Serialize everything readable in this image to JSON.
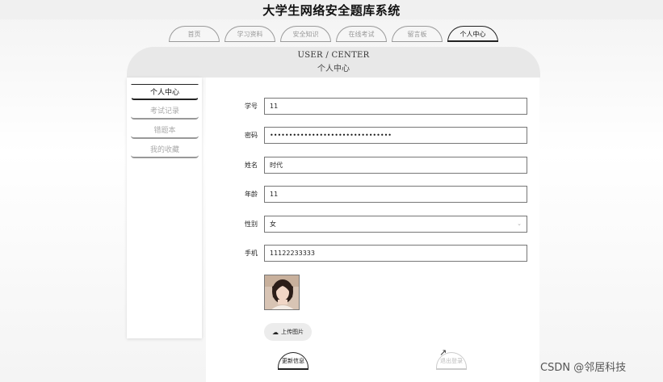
{
  "app": {
    "title": "大学生网络安全题库系统"
  },
  "nav": {
    "tabs": [
      {
        "label": "首页"
      },
      {
        "label": "学习资料"
      },
      {
        "label": "安全知识"
      },
      {
        "label": "在线考试"
      },
      {
        "label": "留言板"
      },
      {
        "label": "个人中心",
        "active": true
      }
    ]
  },
  "banner": {
    "title_en": "USER / CENTER",
    "title_zh": "个人中心"
  },
  "sidebar": {
    "items": [
      {
        "label": "个人中心",
        "active": true
      },
      {
        "label": "考试记录"
      },
      {
        "label": "错题本"
      },
      {
        "label": "我的收藏"
      }
    ]
  },
  "form": {
    "student_id": {
      "label": "学号",
      "value": "11"
    },
    "password": {
      "label": "密码",
      "value": "••••••••••••••••••••••••••••••••"
    },
    "name": {
      "label": "姓名",
      "value": "时代"
    },
    "age": {
      "label": "年龄",
      "value": "11"
    },
    "gender": {
      "label": "性别",
      "value": "女"
    },
    "phone": {
      "label": "手机",
      "value": "11122233333"
    },
    "upload_label": "上传图片",
    "update_label": "更新信息",
    "logout_label": "退出登录"
  },
  "watermark": "CSDN @邻居科技",
  "colors": {
    "accent": "#222222",
    "muted": "#aaaaaa",
    "banner_bg": "#e8e8e8"
  }
}
